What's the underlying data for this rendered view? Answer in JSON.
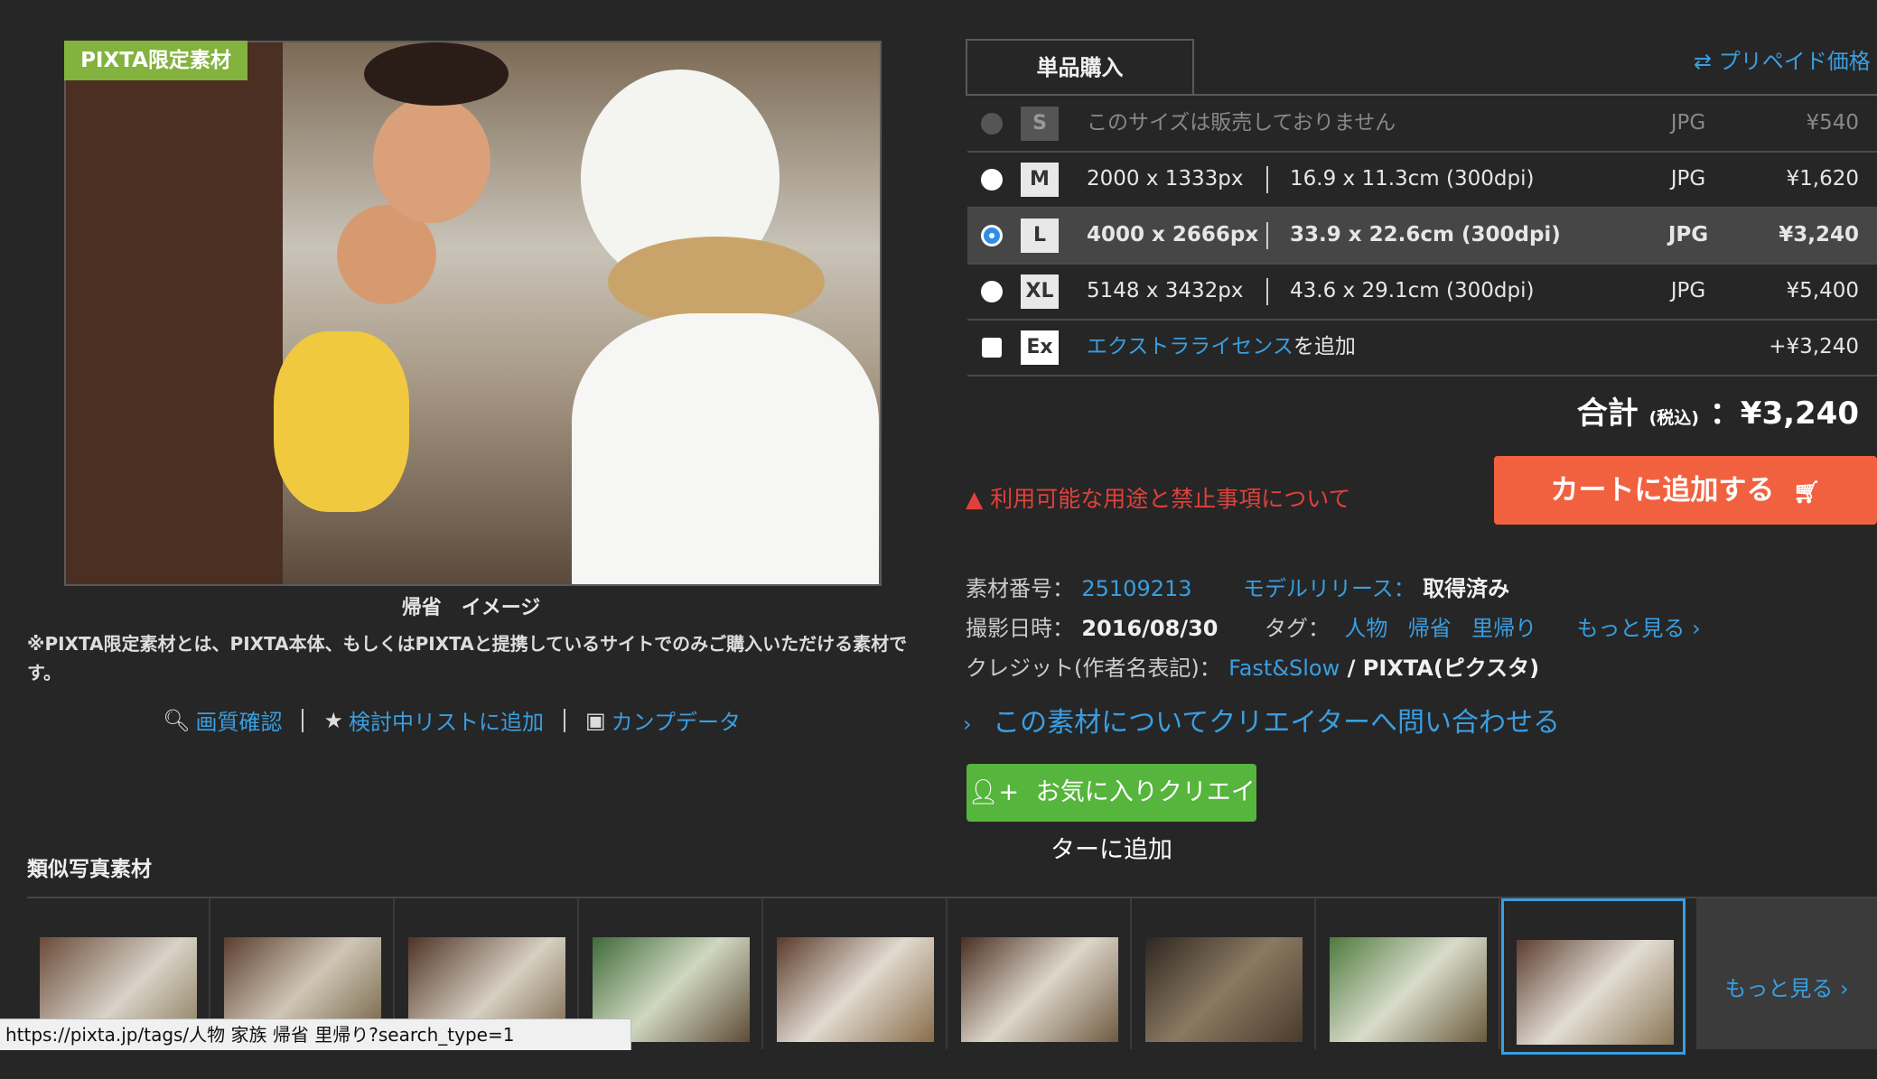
{
  "badge": "PIXTA限定素材",
  "caption": "帰省　イメージ",
  "note": "※PIXTA限定素材とは、PIXTA本体、もしくはPIXTAと提携しているサイトでのみご購入いただける素材です。",
  "tools": {
    "quality": "画質確認",
    "wishlist": "検討中リストに追加",
    "comp": "カンプデータ"
  },
  "purchase": {
    "tab": "単品購入",
    "prepaid": "⇄ プリペイド価格",
    "rows": [
      {
        "size": "S",
        "px": "このサイズは販売しておりません",
        "cm": "",
        "fmt": "JPG",
        "price": "¥540"
      },
      {
        "size": "M",
        "px": "2000 x 1333px",
        "cm": "16.9 x 11.3cm (300dpi)",
        "fmt": "JPG",
        "price": "¥1,620"
      },
      {
        "size": "L",
        "px": "4000 x 2666px",
        "cm": "33.9 x 22.6cm (300dpi)",
        "fmt": "JPG",
        "price": "¥3,240"
      },
      {
        "size": "XL",
        "px": "5148 x 3432px",
        "cm": "43.6 x 29.1cm (300dpi)",
        "fmt": "JPG",
        "price": "¥5,400"
      }
    ],
    "extra": {
      "size": "Ex",
      "link": "エクストラライセンス",
      "suffix": "を追加",
      "price": "+¥3,240"
    },
    "total_label": "合計",
    "total_tax": "(税込)",
    "total_value": "：¥3,240",
    "usage": "利用可能な用途と禁止事項について",
    "cart": "カートに追加する"
  },
  "info": {
    "id_label": "素材番号：",
    "id": "25109213",
    "model_label": "モデルリリース：",
    "model": "取得済み",
    "date_label": "撮影日時：",
    "date": "2016/08/30",
    "tag_label": "タグ：",
    "tags": [
      "人物",
      "帰省",
      "里帰り"
    ],
    "tag_more": "もっと見る ›",
    "credit_label": "クレジット(作者名表記)：",
    "credit_link": "Fast&Slow",
    "credit_rest": " / PIXTA(ピクスタ)"
  },
  "ask": "この素材についてクリエイターへ問い合わせる",
  "fav": "お気に入りクリエイターに追加",
  "similar_title": "類似写真素材",
  "similar_more": "もっと見る ›",
  "status_url": "https://pixta.jp/tags/人物 家族 帰省 里帰り?search_type=1"
}
